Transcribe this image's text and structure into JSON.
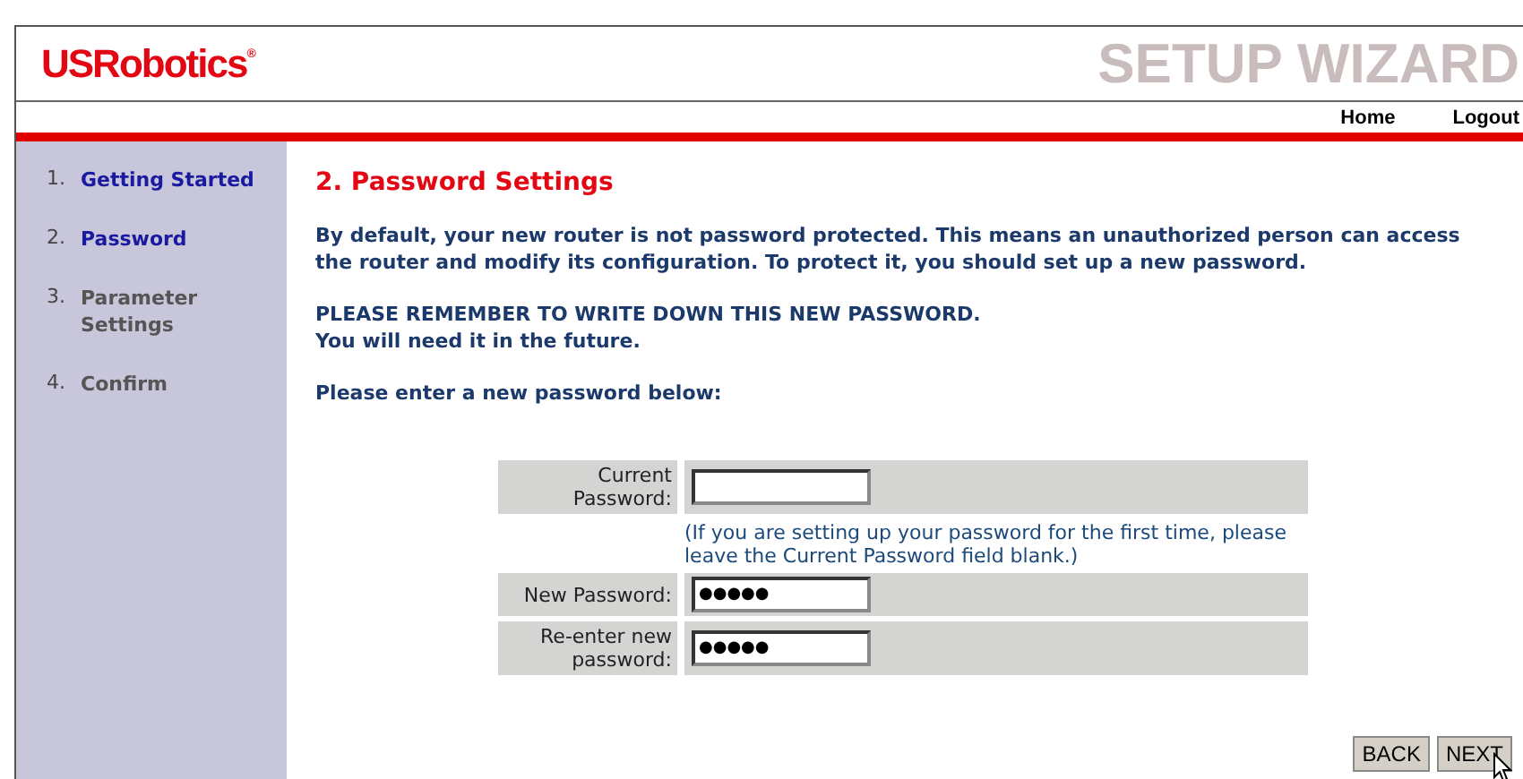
{
  "header": {
    "logo": "USRobotics",
    "logo_mark": "®",
    "banner": "SETUP WIZARD"
  },
  "nav": [
    "Home",
    "Logout"
  ],
  "steps": [
    {
      "number": "1.",
      "label": "Getting Started",
      "disabled": false
    },
    {
      "number": "2.",
      "label": "Password",
      "disabled": false
    },
    {
      "number": "3.",
      "label": "Parameter Settings",
      "disabled": true
    },
    {
      "number": "4.",
      "label": "Confirm",
      "disabled": true
    }
  ],
  "title": "2. Password Settings",
  "intro": "By default, your new router is not password protected. This means an unauthorized person can access the router and modify its configuration. To protect it, you should set up a new password.",
  "reminder": [
    "PLEASE REMEMBER TO WRITE DOWN THIS NEW PASSWORD.",
    "You will need it in the future."
  ],
  "prompt": "Please enter a new password below:",
  "fields": [
    {
      "label": "Current Password:",
      "note": "(If you are setting up your password for the first time, please leave the Current Password field blank.)"
    },
    {
      "label": "New Password:",
      "value": "●●●●●"
    },
    {
      "label": "Re-enter new password:",
      "value": "●●●●●"
    }
  ],
  "buttons": [
    "BACK",
    "NEXT"
  ]
}
